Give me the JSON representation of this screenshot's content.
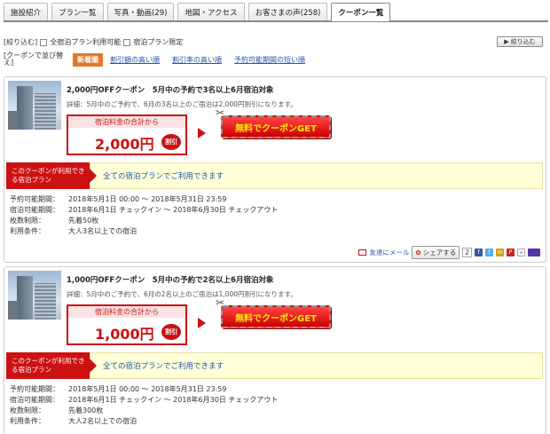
{
  "tabs": [
    {
      "label": "施設紹介"
    },
    {
      "label": "プラン一覧"
    },
    {
      "label": "写真・動画(29)"
    },
    {
      "label": "地図・アクセス"
    },
    {
      "label": "お客さまの声(258)"
    },
    {
      "label": "クーポン一覧"
    }
  ],
  "filter": {
    "label": "[絞り込む]",
    "opt1": "全宿泊プラン利用可能",
    "opt2": "宿泊プラン限定",
    "button": "絞り込む"
  },
  "sort": {
    "label": "[クーポンで並び替え]",
    "current": "新着順",
    "links": [
      "割引額の高い順",
      "割引率の高い順",
      "予約可能期間の短い順"
    ]
  },
  "coupons": [
    {
      "title": "2,000円OFFクーポン　5月中の予約で3名以上6月宿泊対象",
      "detail": "詳細：5月中のご予約で、6月の3名以上のご宿泊は2,000円割引になります。",
      "price_head": "宿泊料金の合計から",
      "amount": "2,000円",
      "discount": "割引",
      "get": "無料でクーポンGET",
      "avail_tag": "このクーポンが利用できる宿泊プラン",
      "avail_text": "全ての宿泊プランでご利用できます",
      "info": [
        {
          "k": "予約可能期間：",
          "v": "2018年5月1日 00:00 ～ 2018年5月31日 23:59"
        },
        {
          "k": "宿泊可能期間：",
          "v": "2018年6月1日 チェックイン ～ 2018年6月30日 チェックアウト"
        },
        {
          "k": "枚数制限：",
          "v": "先着50枚"
        },
        {
          "k": "利用条件：",
          "v": "大人3名以上での宿泊"
        }
      ],
      "share": {
        "mail": "友達にメール",
        "share": "シェアする",
        "count": "2"
      }
    },
    {
      "title": "1,000円OFFクーポン　5月中の予約で2名以上6月宿泊対象",
      "detail": "詳細：5月中のご予約で、6月の2名以上のご宿泊は1,000円割引になります。",
      "price_head": "宿泊料金の合計から",
      "amount": "1,000円",
      "discount": "割引",
      "get": "無料でクーポンGET",
      "avail_tag": "このクーポンが利用できる宿泊プラン",
      "avail_text": "全ての宿泊プランでご利用できます",
      "info": [
        {
          "k": "予約可能期間：",
          "v": "2018年5月1日 00:00 ～ 2018年5月31日 23:59"
        },
        {
          "k": "宿泊可能期間：",
          "v": "2018年6月1日 チェックイン ～ 2018年6月30日 チェックアウト"
        },
        {
          "k": "枚数制限：",
          "v": "先着300枚"
        },
        {
          "k": "利用条件：",
          "v": "大人2名以上での宿泊"
        }
      ]
    }
  ],
  "icons": {
    "facebook": "f",
    "twitter": "t",
    "mixi": "m",
    "hatena": "B"
  }
}
